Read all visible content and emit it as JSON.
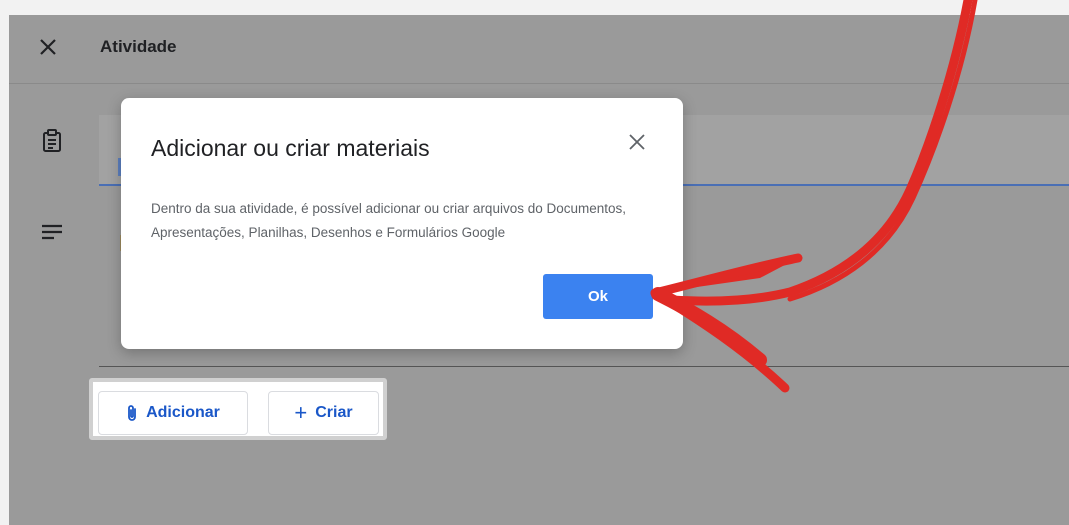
{
  "app": {
    "title": "Atividade"
  },
  "icons": {
    "close": "close-icon",
    "assignment": "assignment-icon",
    "description": "notes-icon",
    "attach": "paperclip-icon",
    "create": "plus-icon"
  },
  "attach_bar": {
    "add_label": "Adicionar",
    "create_label": "Criar",
    "create_icon": "+"
  },
  "dialog": {
    "title": "Adicionar ou criar materiais",
    "body": "Dentro da sua atividade, é possível adicionar ou criar arquivos do Documentos, Apresentações, Planilhas, Desenhos e Formulários Google",
    "ok_label": "Ok"
  },
  "colors": {
    "overlay": "#9a9a9a",
    "accent_blue": "#3b82f0",
    "link_blue": "#1a57c8",
    "annotation_arrow": "#e02a25"
  }
}
